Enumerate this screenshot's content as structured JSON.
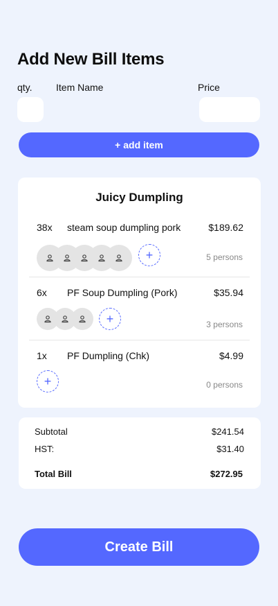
{
  "form": {
    "title": "Add New Bill Items",
    "qty_label": "qty.",
    "name_label": "Item Name",
    "price_label": "Price",
    "qty_value": "",
    "name_value": "",
    "price_value": "",
    "add_item_label": "+ add item"
  },
  "bill": {
    "restaurant": "Juicy Dumpling",
    "items": [
      {
        "qty": "38x",
        "name": "steam soup dumpling pork",
        "price": "$189.62",
        "person_count": 5,
        "persons_label": "5 persons"
      },
      {
        "qty": "6x",
        "name": "PF Soup Dumpling (Pork)",
        "price": "$35.94",
        "person_count": 3,
        "persons_label": "3 persons"
      },
      {
        "qty": "1x",
        "name": "PF Dumpling (Chk)",
        "price": "$4.99",
        "person_count": 0,
        "persons_label": "0 persons"
      }
    ]
  },
  "summary": {
    "subtotal_label": "Subtotal",
    "subtotal_value": "$241.54",
    "hst_label": "HST:",
    "hst_value": "$31.40",
    "total_label": "Total Bill",
    "total_value": "$272.95"
  },
  "actions": {
    "create_label": "Create Bill"
  },
  "colors": {
    "accent": "#5468FF",
    "background": "#EEF3FD"
  }
}
